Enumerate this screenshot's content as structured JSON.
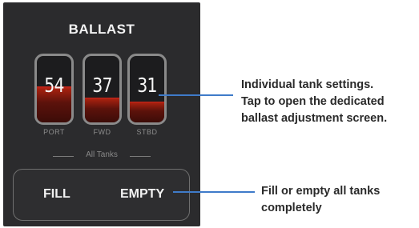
{
  "panel": {
    "title": "BALLAST",
    "tanks": [
      {
        "label": "PORT",
        "value": "54",
        "fill_percent": 54
      },
      {
        "label": "FWD",
        "value": "37",
        "fill_percent": 37
      },
      {
        "label": "STBD",
        "value": "31",
        "fill_percent": 31
      }
    ],
    "all_tanks_label": "All Tanks",
    "buttons": {
      "fill": "FILL",
      "empty": "EMPTY"
    }
  },
  "callouts": {
    "tanks_note": [
      "Individual tank settings.",
      "Tap to open the dedicated",
      "ballast adjustment screen."
    ],
    "all_note": [
      "Fill or empty all tanks",
      "completely"
    ]
  },
  "colors": {
    "panel_bg": "#2b2b2d",
    "fill_red": "#c8251b",
    "callout_line": "#3f7bc9"
  }
}
